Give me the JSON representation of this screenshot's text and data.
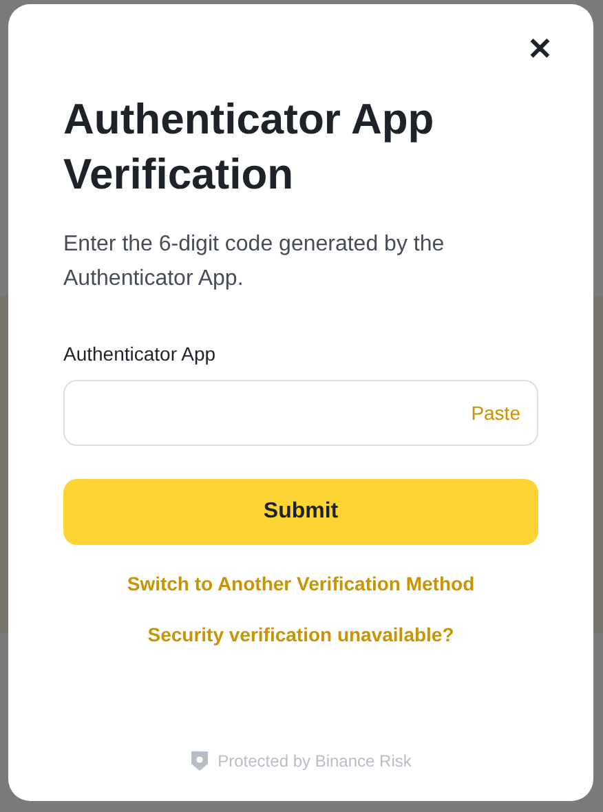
{
  "dialog": {
    "close": "✕",
    "title": "Authenticator App Verification",
    "description": "Enter the 6-digit code generated by the Authenticator App.",
    "field": {
      "label": "Authenticator App",
      "paste": "Paste"
    },
    "submit": "Submit",
    "links": [
      "Switch to Another Verification Method",
      "Security verification unavailable?"
    ],
    "footer": "Protected by Binance Risk"
  }
}
